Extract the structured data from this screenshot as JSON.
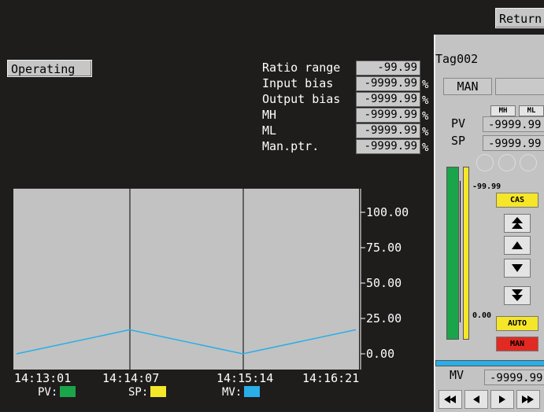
{
  "header": {
    "return_label": "Return"
  },
  "status": {
    "mode_label": "Operating"
  },
  "params": [
    {
      "label": "Ratio range",
      "value": "-99.99",
      "unit": ""
    },
    {
      "label": "Input bias",
      "value": "-9999.99",
      "unit": "%"
    },
    {
      "label": "Output bias",
      "value": "-9999.99",
      "unit": "%"
    },
    {
      "label": "MH",
      "value": "-9999.99",
      "unit": "%"
    },
    {
      "label": "ML",
      "value": "-9999.99",
      "unit": "%"
    },
    {
      "label": "Man.ptr.",
      "value": "-9999.99",
      "unit": "%"
    }
  ],
  "chart_data": {
    "type": "line",
    "categories": [
      "14:13:01",
      "14:14:07",
      "14:15:14",
      "14:16:21"
    ],
    "y_ticks": [
      "100.00",
      "75.00",
      "50.00",
      "25.00",
      "0.00"
    ],
    "ylim": [
      0,
      100
    ],
    "grid": "vertical",
    "series": [
      {
        "name": "MV",
        "color": "#29aee8",
        "x": [
          0,
          1,
          2,
          3
        ],
        "values": [
          0,
          17,
          0,
          17
        ]
      }
    ],
    "legend": [
      {
        "label": "PV:",
        "color": "#1aa54a"
      },
      {
        "label": "SP:",
        "color": "#f5e629"
      },
      {
        "label": "MV:",
        "color": "#29aee8"
      }
    ]
  },
  "faceplate": {
    "tag": "Tag002",
    "mode": "MAN",
    "mh_label": "MH",
    "ml_label": "ML",
    "pv_label": "PV",
    "pv_value": "-9999.99",
    "sp_label": "SP",
    "sp_value": "-9999.99",
    "scale_high": "-99.99",
    "scale_low": "0.00",
    "cas_label": "CAS",
    "auto_label": "AUTO",
    "man_label": "MAN",
    "mv_label": "MV",
    "mv_value": "-9999.99",
    "colors": {
      "pv_bar": "#1aa54a",
      "sp_bar": "#f5e629",
      "cas": "#f5e629",
      "auto": "#f5e629",
      "man": "#e22a22",
      "mv_bar": "#29aee8"
    }
  }
}
